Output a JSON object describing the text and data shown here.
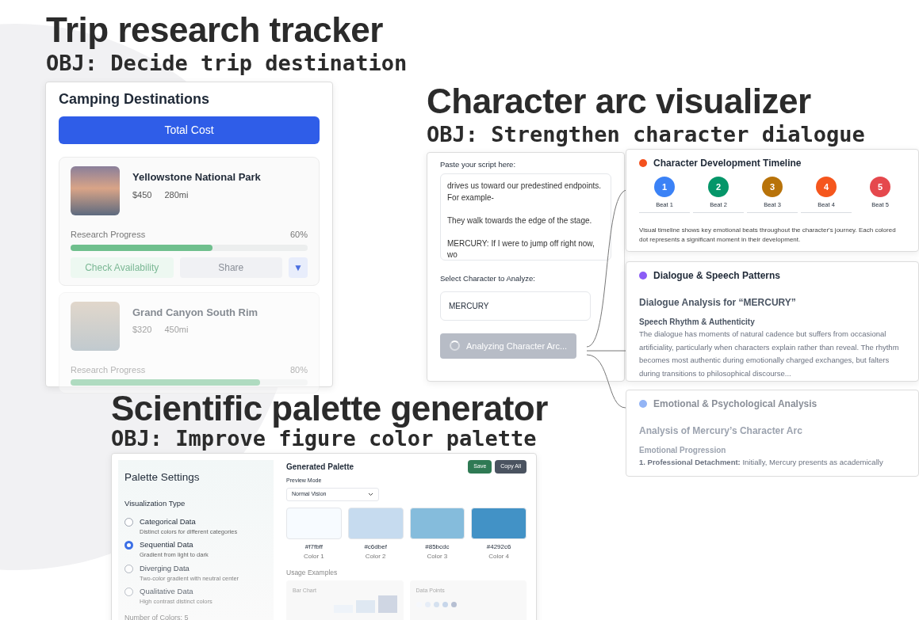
{
  "trip_tracker": {
    "title": "Trip research tracker",
    "objective": "OBJ: Decide trip destination",
    "panel_title": "Camping Destinations",
    "total_button": "Total Cost",
    "destinations": [
      {
        "name": "Yellowstone National Park",
        "price": "$450",
        "distance": "280mi",
        "progress_label": "Research Progress",
        "progress_value": "60%",
        "level": 0.6,
        "actions": [
          "Check Availability",
          "Share",
          "▼"
        ]
      },
      {
        "name": "Grand Canyon South Rim",
        "price": "$320",
        "distance": "450mi",
        "progress_label": "Research Progress",
        "progress_value": "80%",
        "level": 0.8
      }
    ]
  },
  "character_arc": {
    "title": "Character arc visualizer",
    "objective": "OBJ: Strengthen character dialogue",
    "script_label": "Paste your script here:",
    "script_text": "drives us toward our predestined endpoints.\nFor example-\n\nThey walk towards the edge of the stage.\n\nMERCURY: If I were to jump off right now, wo",
    "select_label": "Select Character to Analyze:",
    "select_value": "MERCURY",
    "analyze_button": {
      "label": "Analyzing Character Arc...",
      "disabled": true
    },
    "timeline": {
      "title": "Character Development Timeline",
      "color": "#f4511e",
      "caption": "Visual timeline shows key emotional beats throughout the character's journey. Each colored dot represents a significant moment in their development.",
      "beats": [
        {
          "number": "1",
          "label": "Beat 1",
          "color": "#3b82f6"
        },
        {
          "number": "2",
          "label": "Beat 2",
          "color": "#059669"
        },
        {
          "number": "3",
          "label": "Beat 3",
          "color": "#b8730a"
        },
        {
          "number": "4",
          "label": "Beat 4",
          "color": "#f5561d"
        },
        {
          "number": "5",
          "label": "Beat 5",
          "color": "#e5484d"
        }
      ]
    },
    "dialogue": {
      "title": "Dialogue & Speech Patterns",
      "color": "#8b5cf6",
      "heading": "Dialogue Analysis for “MERCURY”",
      "subheading": "Speech Rhythm & Authenticity",
      "text": "The dialogue has moments of natural cadence but suffers from occasional artificiality, particularly when characters explain rather than reveal. The rhythm becomes most authentic during emotionally charged exchanges, but falters during transitions to philosophical discourse..."
    },
    "emotional": {
      "title": "Emotional & Psychological Analysis",
      "color": "#93b4f5",
      "heading": "Analysis of Mercury’s Character Arc",
      "subheading": "Emotional Progression",
      "text": "**1. Professional Detachment:** Initially, Mercury presents as academically"
    }
  },
  "palette": {
    "title": "Scientific palette generator",
    "objective": "OBJ: Improve figure color palette",
    "settings_title": "Palette Settings",
    "type_label": "Visualization Type",
    "types": [
      {
        "name": "Categorical Data",
        "description": "Distinct colors for different categories",
        "selected": false
      },
      {
        "name": "Sequential Data",
        "description": "Gradient from light to dark",
        "selected": true
      },
      {
        "name": "Diverging Data",
        "description": "Two-color gradient with neutral center",
        "selected": false
      },
      {
        "name": "Qualitative Data",
        "description": "High contrast distinct colors",
        "selected": false
      }
    ],
    "colors_count_label": "Number of Colors: 5",
    "generated_title": "Generated Palette",
    "buttons": [
      {
        "label": "Save",
        "kind": "success"
      },
      {
        "label": "Copy All",
        "kind": "dark"
      }
    ],
    "preview_label": "Preview Mode",
    "preview_value": "Normal Vision",
    "swatches": [
      {
        "hex": "#f7fbff",
        "label": "Color 1",
        "color": "#f7fbff"
      },
      {
        "hex": "#c6dbef",
        "label": "Color 2",
        "color": "#c6dbef"
      },
      {
        "hex": "#85bcdc",
        "label": "Color 3",
        "color": "#85bcdc"
      },
      {
        "hex": "#4292c6",
        "label": "Color 4",
        "color": "#4292c6"
      }
    ],
    "usage_title": "Usage Examples",
    "examples": [
      {
        "title": "Bar Chart",
        "kind": "bars"
      },
      {
        "title": "Data Points",
        "kind": "points"
      }
    ]
  }
}
